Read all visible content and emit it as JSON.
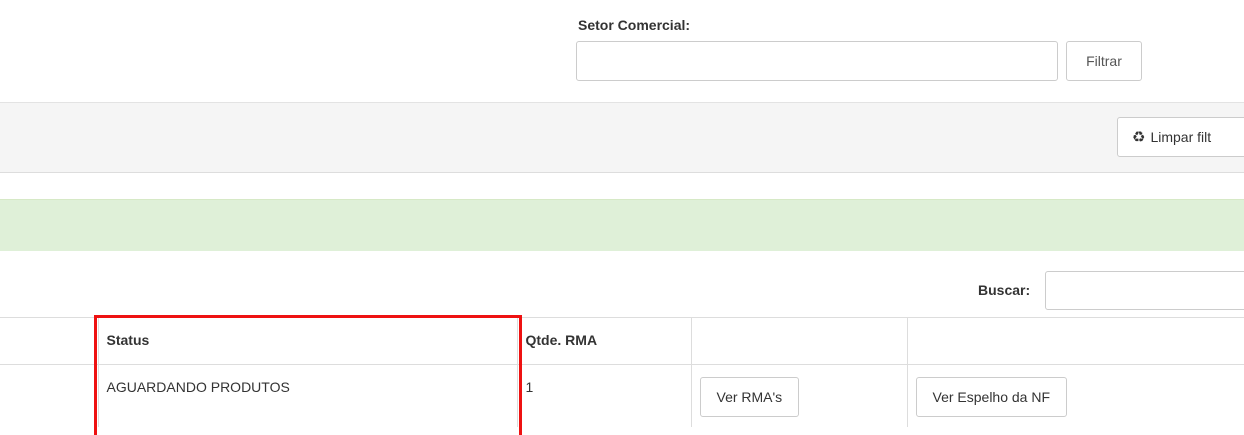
{
  "filter": {
    "setor_label": "Setor Comercial:",
    "setor_value": "",
    "filtrar_label": "Filtrar"
  },
  "toolbar": {
    "limpar_label": "Limpar filt",
    "limpar_icon": "recycle-icon"
  },
  "search": {
    "label": "Buscar:",
    "value": ""
  },
  "table": {
    "headers": [
      "",
      "Status",
      "Qtde. RMA",
      "",
      ""
    ],
    "rows": [
      {
        "status": "AGUARDANDO PRODUTOS",
        "qtde_rma": "1",
        "ver_rma_label": "Ver RMA's",
        "ver_espelho_label": "Ver Espelho da NF"
      }
    ]
  },
  "colors": {
    "alert_bg": "#dff0d8",
    "toolbar_bg": "#f5f5f5",
    "highlight_box": "#ee1111"
  }
}
